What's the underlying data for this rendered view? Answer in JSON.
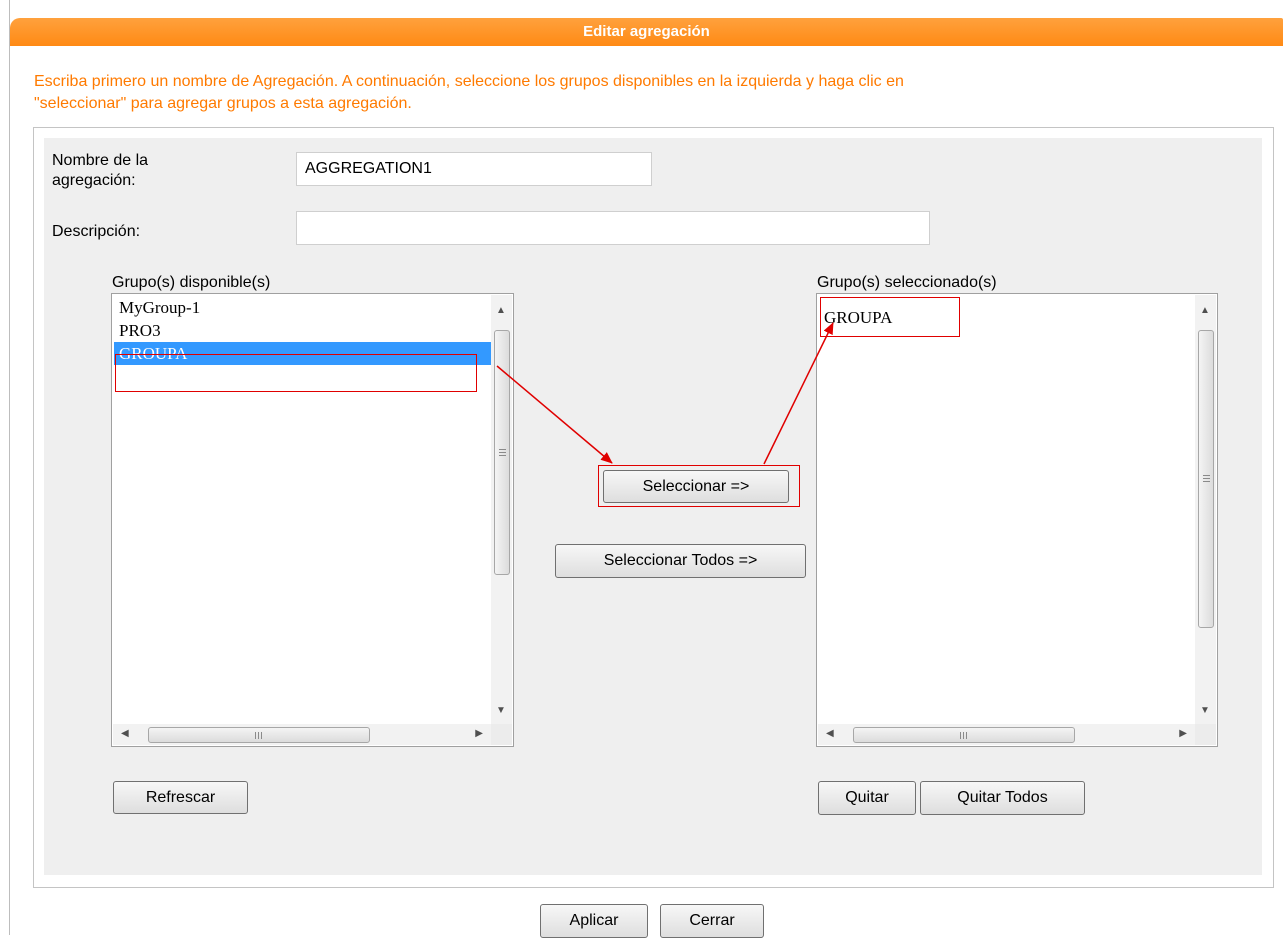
{
  "dialog": {
    "title": "Editar agregación",
    "instructions_line1": "Escriba primero un nombre de Agregación. A continuación, seleccione los grupos disponibles en la izquierda y haga clic en",
    "instructions_line2": "\"seleccionar\" para agregar grupos a esta agregación."
  },
  "form": {
    "name_label_line1": "Nombre de la",
    "name_label_line2": "agregación:",
    "name_value": "AGGREGATION1",
    "description_label": "Descripción:",
    "description_value": ""
  },
  "available": {
    "label": "Grupo(s) disponible(s)",
    "items": [
      "MyGroup-1",
      "PRO3",
      "GROUPA"
    ],
    "selected": "GROUPA"
  },
  "selected_groups": {
    "label": "Grupo(s) seleccionado(s)",
    "items": [
      "GROUPA"
    ]
  },
  "buttons": {
    "select": "Seleccionar =>",
    "select_all": "Seleccionar Todos =>",
    "refresh": "Refrescar",
    "remove": "Quitar",
    "remove_all": "Quitar Todos",
    "apply": "Aplicar",
    "close": "Cerrar"
  },
  "scroll_glyphs": {
    "up": "▲",
    "down": "▼",
    "left": "◀",
    "right": "▶"
  },
  "colors": {
    "title_bar": "#ff8a14",
    "instructions_text": "#ff7a00",
    "selection": "#3399ff",
    "annotation": "#e00000"
  }
}
